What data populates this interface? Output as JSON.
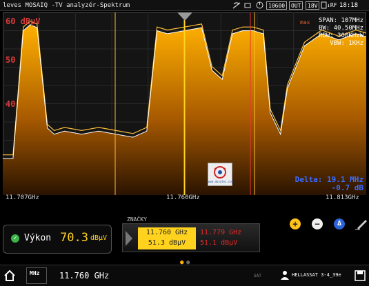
{
  "statusbar": {
    "title": "leves MOSAIQ -TV analyzér-Spektrum",
    "freq_box": "10600",
    "out_box": "OUT",
    "volt_box": "18V",
    "rf_label": "↓RF",
    "time": "18:18"
  },
  "plot": {
    "ref_level": "60 dBµV",
    "y_labels": [
      "50",
      "40"
    ],
    "max_label": "max",
    "span": "SPAN: 107MHz",
    "bw": "BW: 40.50MHz",
    "rbw": "RBW: 300KHzW",
    "vbw": "VBW:     1KHz",
    "delta_line1": "Delta: 19.1 MHz",
    "delta_line2": "-0.7 dB",
    "x_left": "11.707GHz",
    "x_center": "11.760GHz",
    "x_right": "11.813GHz",
    "logo_url": "www.dusatec.com",
    "trace_color": "#f5a623",
    "fill_top": "#ffb400"
  },
  "chart_data": {
    "type": "area",
    "xlabel": "",
    "ylabel": "",
    "x_range_ghz": [
      11.707,
      11.813
    ],
    "ylim": [
      0,
      60
    ],
    "x": [
      11.707,
      11.71,
      11.713,
      11.715,
      11.717,
      11.72,
      11.722,
      11.725,
      11.73,
      11.735,
      11.74,
      11.745,
      11.749,
      11.752,
      11.755,
      11.76,
      11.765,
      11.768,
      11.771,
      11.774,
      11.777,
      11.78,
      11.783,
      11.785,
      11.788,
      11.79,
      11.795,
      11.8,
      11.805,
      11.81,
      11.813
    ],
    "y": [
      12,
      12,
      54,
      56,
      55,
      22,
      20,
      21,
      20,
      21,
      20,
      19,
      21,
      54,
      53,
      54,
      55,
      41,
      38,
      53,
      54,
      54,
      53,
      27,
      20,
      35,
      49,
      53,
      51,
      53,
      52
    ]
  },
  "markers_panel": {
    "label": "ZNAČKY",
    "m1_freq": "11.760 GHz",
    "m1_level": "51.3 dBµV",
    "m2_freq": "11.779 GHz",
    "m2_level": "51.1 dBµV"
  },
  "power": {
    "label": "Výkon",
    "value": "70.3",
    "unit": "dBµV"
  },
  "bottom": {
    "mhz_label": "MHz",
    "frequency": "11.760 GHz",
    "sat_label": "SAT",
    "satellite": "HELLASSAT 3-4_39e"
  }
}
